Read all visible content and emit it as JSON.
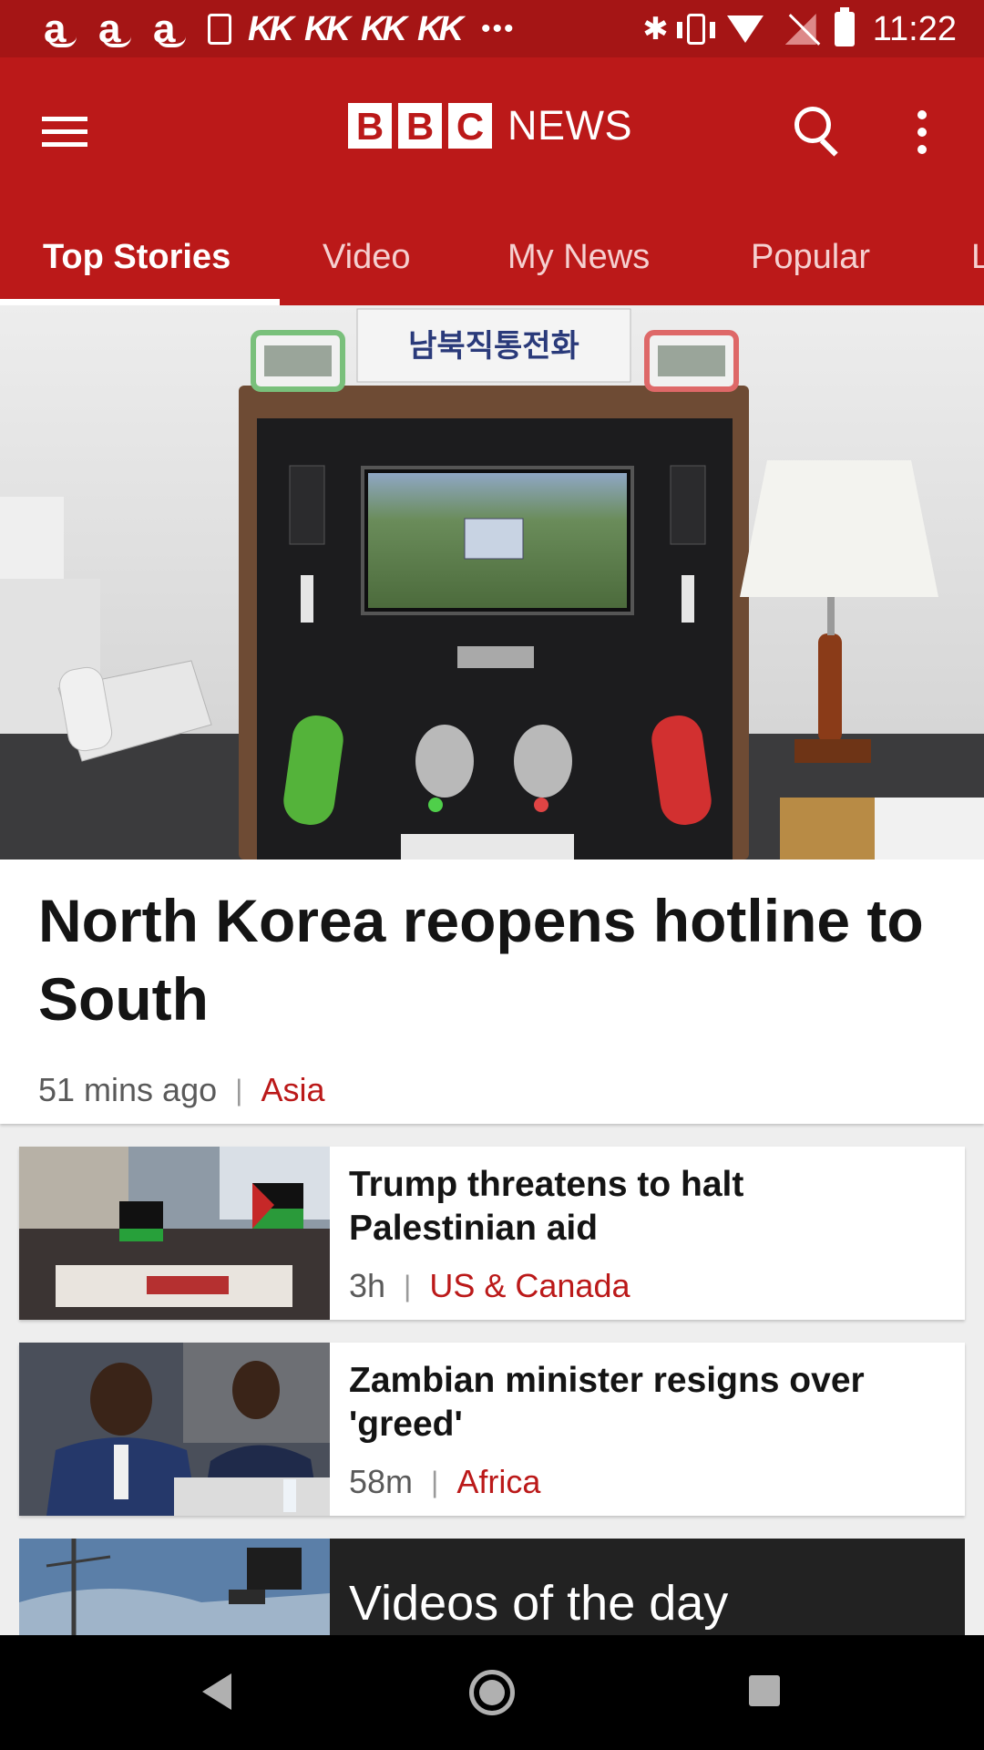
{
  "status_bar": {
    "time": "11:22",
    "notification_icons": [
      "amazon-icon",
      "amazon-icon",
      "amazon-icon",
      "sim-card-icon",
      "kk-icon",
      "kk-icon",
      "kk-icon",
      "kk-icon"
    ],
    "amazon_glyph": "a",
    "kk_glyph": "KK",
    "overflow_glyph": "•••",
    "bluetooth_glyph": "✱"
  },
  "app_bar": {
    "logo_letters": [
      "B",
      "B",
      "C"
    ],
    "logo_word": "NEWS",
    "brand_color": "#bb1919"
  },
  "tabs": [
    {
      "label": "Top Stories",
      "active": true
    },
    {
      "label": "Video",
      "active": false
    },
    {
      "label": "My News",
      "active": false
    },
    {
      "label": "Popular",
      "active": false
    },
    {
      "label": "L",
      "active": false
    }
  ],
  "hero": {
    "title": "North Korea reopens hotline to South",
    "time": "51 mins ago",
    "separator": "|",
    "category": "Asia",
    "screen_text": "남북직통전화"
  },
  "stories": [
    {
      "title": "Trump threatens to halt Palestinian aid",
      "time": "3h",
      "separator": "|",
      "category": "US & Canada"
    },
    {
      "title": "Zambian minister resigns over 'greed'",
      "time": "58m",
      "separator": "|",
      "category": "Africa"
    }
  ],
  "video_section": {
    "title": "Videos of the day"
  }
}
